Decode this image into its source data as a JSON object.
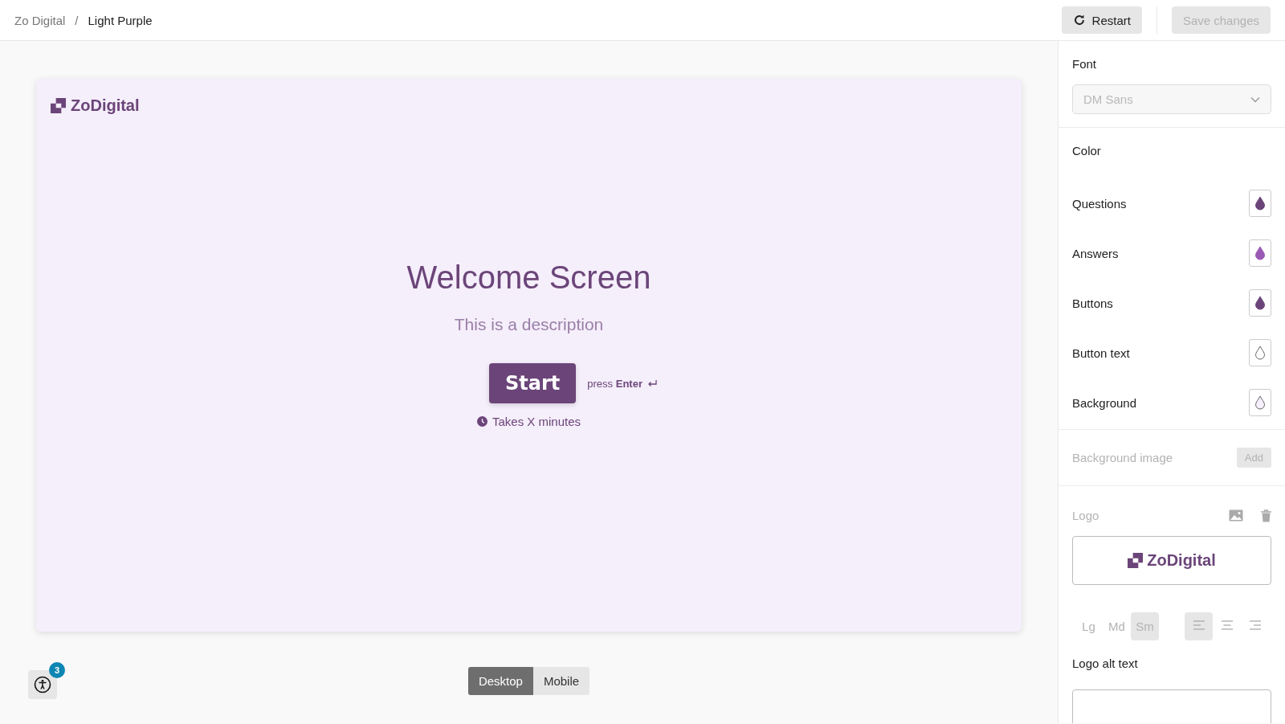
{
  "breadcrumb": [
    {
      "label": "Zo Digital"
    },
    {
      "label": "Light Purple"
    }
  ],
  "breadcrumb_separator": "/",
  "header_buttons": {
    "restart": {
      "label": "Restart",
      "disabled": false
    },
    "save": {
      "label": "Save changes",
      "disabled": true
    }
  },
  "preview": {
    "logo_text": "ZoDigital",
    "title": "Welcome Screen",
    "description": "This is a description",
    "start_button": "Start",
    "hint": "press **Enter**",
    "duration": "Takes X minutes"
  },
  "accessibility": {
    "badge": "3"
  },
  "view_toggle": [
    {
      "label": "Desktop",
      "selected": true
    },
    {
      "label": "Mobile",
      "selected": false
    }
  ],
  "panel": {
    "font": {
      "label": "Font",
      "value": "DM Sans",
      "disabled": true
    },
    "color": {
      "label": "Color",
      "items": [
        {
          "label": "Questions",
          "color": "#6b4579"
        },
        {
          "label": "Answers",
          "color": "#9b59b6"
        },
        {
          "label": "Buttons",
          "color": "#6b4579"
        },
        {
          "label": "Button text",
          "color": "#ffffff"
        },
        {
          "label": "Background",
          "color": "#f5eefb"
        }
      ]
    },
    "background_image": {
      "label": "Background image",
      "button": "Add",
      "disabled": true
    },
    "logo": {
      "label": "Logo",
      "preview_text": "ZoDigital",
      "sizes": [
        {
          "label": "Lg",
          "selected": false
        },
        {
          "label": "Md",
          "selected": false
        },
        {
          "label": "Sm",
          "selected": true
        }
      ],
      "alignments": [
        {
          "kind": "left",
          "selected": true
        },
        {
          "kind": "center",
          "selected": false
        },
        {
          "kind": "right",
          "selected": false
        }
      ],
      "alt_text_label": "Logo alt text"
    }
  }
}
